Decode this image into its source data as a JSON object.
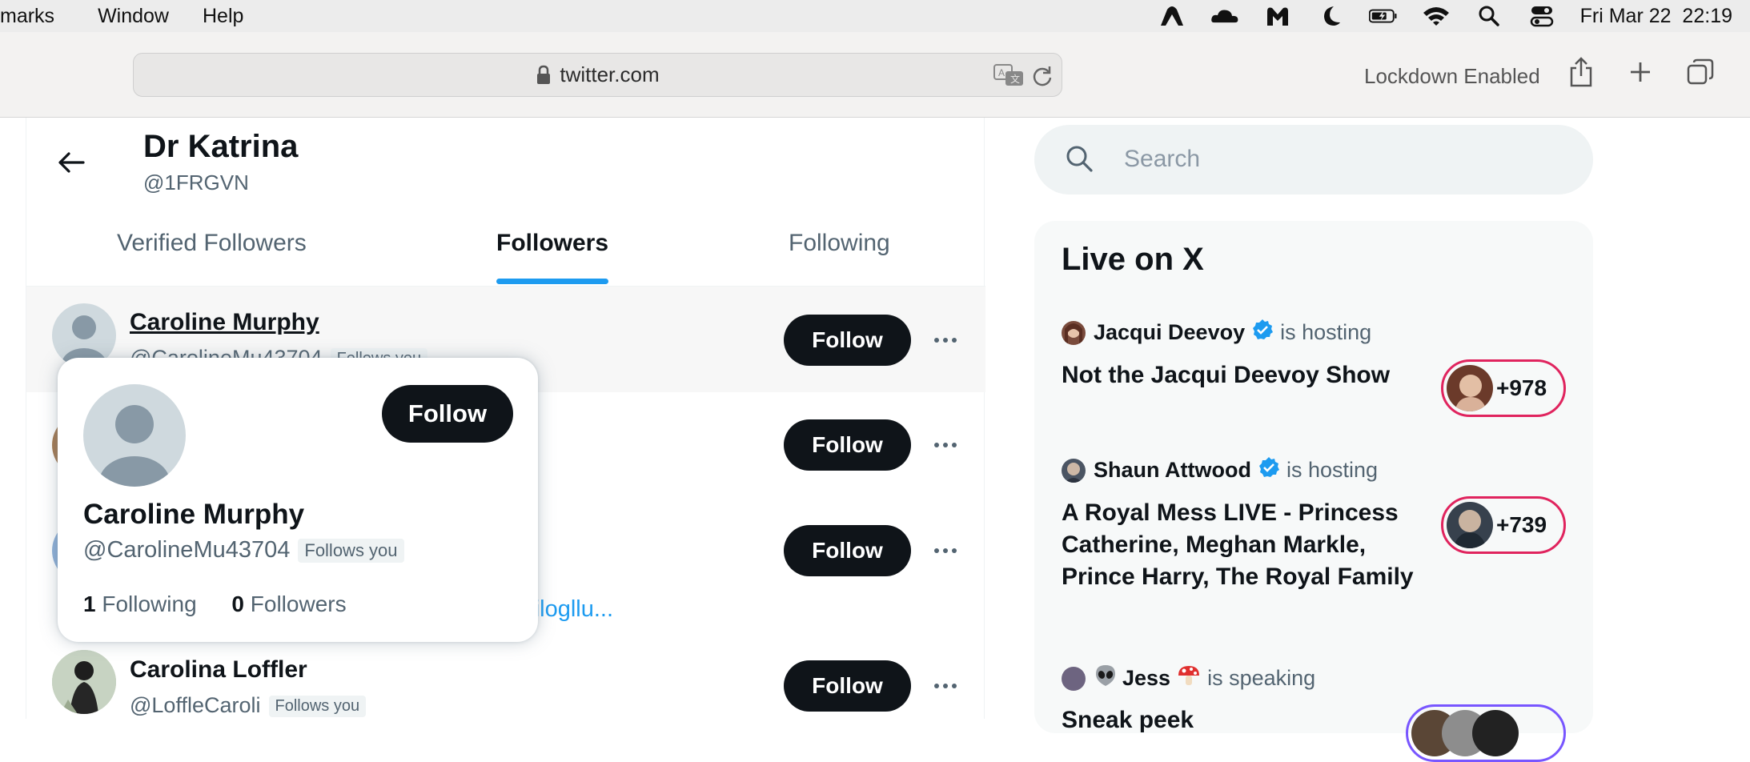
{
  "menubar": {
    "items": [
      "marks",
      "Window",
      "Help"
    ],
    "datetime": "Fri Mar 22  22:19"
  },
  "browser": {
    "url": "twitter.com",
    "lockdown": "Lockdown Enabled"
  },
  "profile": {
    "name": "Dr Katrina",
    "handle": "@1FRGVN"
  },
  "tabs": [
    {
      "label": "Verified Followers"
    },
    {
      "label": "Followers",
      "active": true
    },
    {
      "label": "Following"
    }
  ],
  "followers": [
    {
      "name": "Caroline Murphy",
      "handle": "@CarolineMu43704",
      "follows_you": "Follows you",
      "button": "Follow"
    },
    {
      "button": "Follow"
    },
    {
      "button": "Follow",
      "bio_link": "nalilogllu..."
    },
    {
      "name": "Carolina Loffler",
      "handle": "@LoffleCaroli",
      "follows_you": "Follows you",
      "button": "Follow"
    }
  ],
  "hover_card": {
    "name": "Caroline Murphy",
    "handle": "@CarolineMu43704",
    "follows_you": "Follows you",
    "button": "Follow",
    "following_count": "1",
    "following_label": "Following",
    "followers_count": "0",
    "followers_label": "Followers"
  },
  "search": {
    "placeholder": "Search"
  },
  "live": {
    "title": "Live on X",
    "spaces": [
      {
        "host": "Jacqui Deevoy",
        "action": "is hosting",
        "title": "Not the Jacqui Deevoy Show",
        "count": "+978",
        "ring_color": "#e0245e"
      },
      {
        "host": "Shaun Attwood",
        "action": "is hosting",
        "title": "A Royal Mess LIVE - Princess Catherine, Meghan Markle, Prince Harry, The Royal Family",
        "count": "+739",
        "ring_color": "#e0245e"
      },
      {
        "host": "Jess",
        "action": "is speaking",
        "title": "Sneak peek",
        "ring_color": "#7856ff"
      }
    ]
  },
  "colors": {
    "accent": "#1d9bf0",
    "button": "#0f1419",
    "space_ring": "#e0245e"
  }
}
